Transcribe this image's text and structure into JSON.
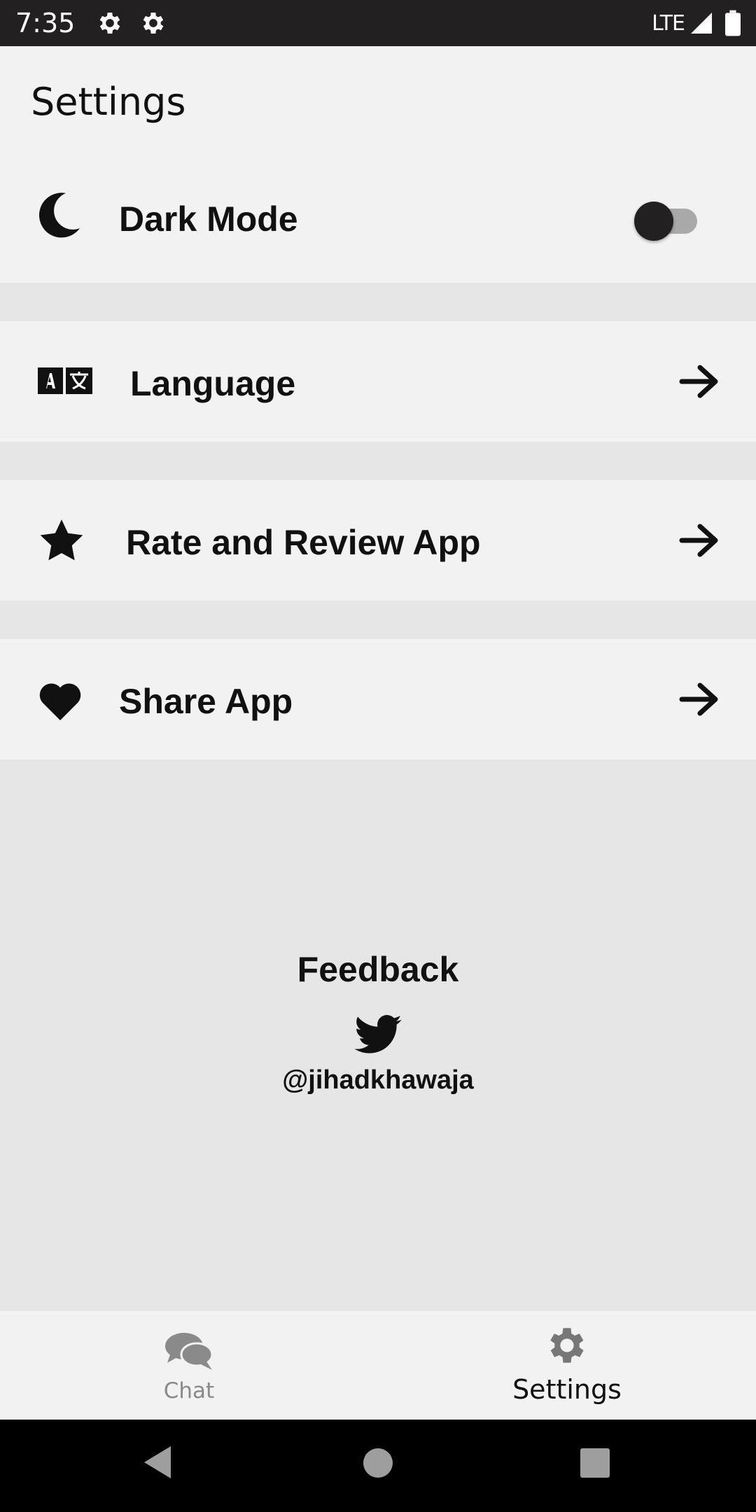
{
  "status_bar": {
    "time": "7:35",
    "network": "LTE",
    "icons": [
      "gear-icon",
      "gear-icon",
      "signal-icon",
      "battery-icon"
    ]
  },
  "header": {
    "title": "Settings"
  },
  "settings": {
    "dark_mode": {
      "label": "Dark Mode",
      "icon": "moon-icon",
      "enabled": false
    },
    "language": {
      "label": "Language",
      "icon": "translate-icon"
    },
    "rate": {
      "label": "Rate and Review App",
      "icon": "star-icon"
    },
    "share": {
      "label": "Share App",
      "icon": "heart-icon"
    }
  },
  "feedback": {
    "title": "Feedback",
    "icon": "twitter-icon",
    "handle": "@jihadkhawaja"
  },
  "bottom_nav": {
    "items": [
      {
        "label": "Chat",
        "icon": "chat-icon",
        "active": false
      },
      {
        "label": "Settings",
        "icon": "gear-icon",
        "active": true
      }
    ]
  },
  "colors": {
    "background": "#e6e6e6",
    "card": "#f2f2f2",
    "status_bar": "#232021",
    "text": "#111111",
    "inactive": "#8a8a8a"
  }
}
